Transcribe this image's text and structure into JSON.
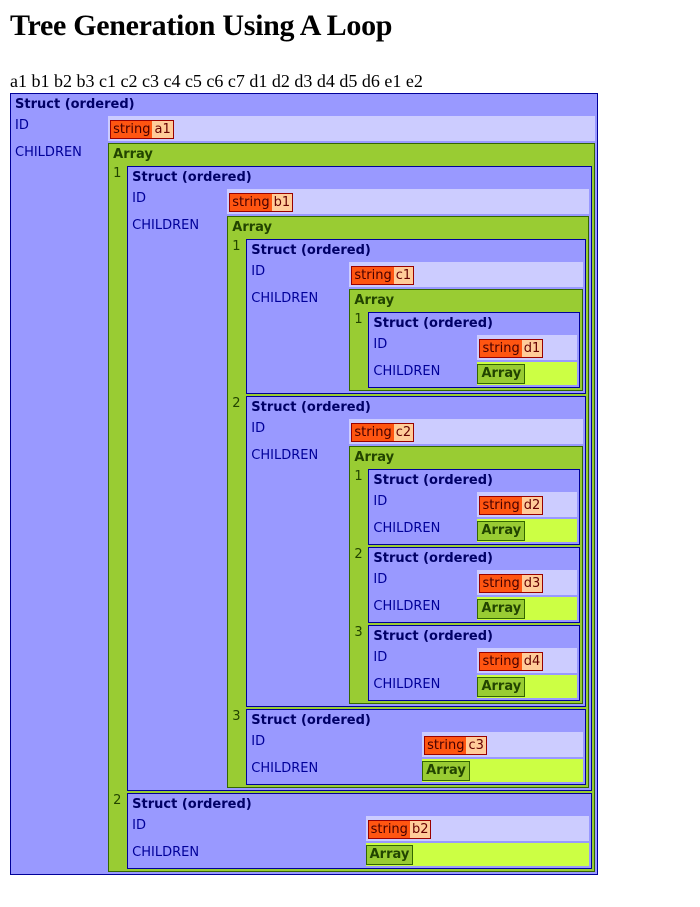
{
  "page": {
    "title": "Tree Generation Using A Loop",
    "id_list": "a1 b1 b2 b3 c1 c2 c3 c4 c5 c6 c7 d1 d2 d3 d4 d5 d6 e1 e2"
  },
  "labels": {
    "struct": "Struct (ordered)",
    "array": "Array",
    "id_key": "ID",
    "children_key": "CHILDREN",
    "string_type": "string"
  },
  "colors": {
    "struct_bg": "#9999ff",
    "struct_value_bg": "#ccccff",
    "array_bg": "#99cc33",
    "array_fill": "#ccff44",
    "string_type_bg": "#ff5511",
    "string_value_bg": "#ffcc99"
  },
  "tree": {
    "id": "a1",
    "children": [
      {
        "id": "b1",
        "children": [
          {
            "id": "c1",
            "children": [
              {
                "id": "d1",
                "children": []
              }
            ]
          },
          {
            "id": "c2",
            "children": [
              {
                "id": "d2",
                "children": []
              },
              {
                "id": "d3",
                "children": []
              },
              {
                "id": "d4",
                "children": []
              }
            ]
          },
          {
            "id": "c3",
            "children": []
          }
        ]
      },
      {
        "id": "b2",
        "children": null
      }
    ]
  }
}
